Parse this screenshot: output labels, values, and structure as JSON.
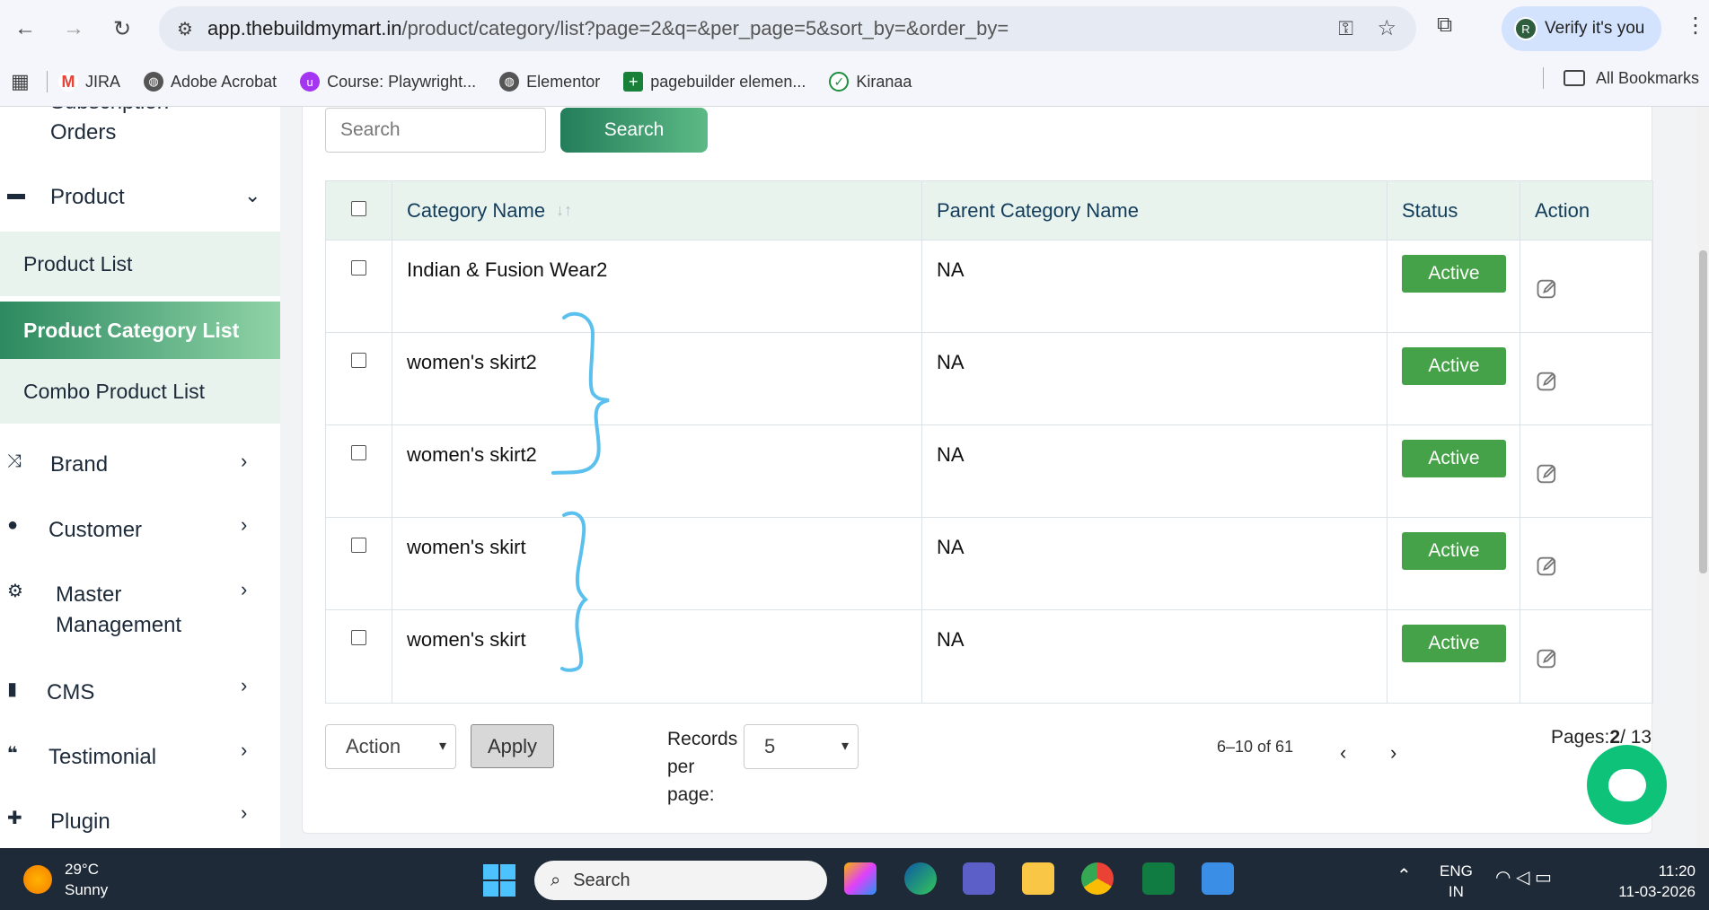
{
  "browser": {
    "url_host": "app.thebuildmymart.in",
    "url_path": "/product/category/list?page=2&q=&per_page=5&sort_by=&order_by=",
    "verify_label": "Verify it's you",
    "avatar_letter": "R"
  },
  "bookmarks": {
    "items": [
      {
        "label": "JIRA",
        "icon": "gmail-icon",
        "color": "#ea4335"
      },
      {
        "label": "Adobe Acrobat",
        "icon": "globe-icon",
        "color": "#555555"
      },
      {
        "label": "Course: Playwright...",
        "icon": "udemy-icon",
        "color": "#a435f0"
      },
      {
        "label": "Elementor",
        "icon": "globe-icon",
        "color": "#555555"
      },
      {
        "label": "pagebuilder elemen...",
        "icon": "sheets-icon",
        "color": "#188038"
      },
      {
        "label": "Kiranaa",
        "icon": "check-icon",
        "color": "#1e8e3e"
      }
    ],
    "all_label": "All Bookmarks"
  },
  "sidebar": {
    "partial_label": "Subscription",
    "orders_label": "Orders",
    "product_label": "Product",
    "sub_items": [
      "Product List",
      "Product Category List",
      "Combo Product List"
    ],
    "items": [
      {
        "label": "Brand",
        "icon": "shuffle-icon"
      },
      {
        "label": "Customer",
        "icon": "user-icon"
      },
      {
        "label": "Master Management",
        "icon": "user-gear-icon"
      },
      {
        "label": "CMS",
        "icon": "file-icon"
      },
      {
        "label": "Testimonial",
        "icon": "quote-icon"
      },
      {
        "label": "Plugin",
        "icon": "puzzle-icon"
      }
    ]
  },
  "search": {
    "placeholder": "Search",
    "button_label": "Search"
  },
  "table": {
    "headers": [
      "Category Name",
      "Parent Category Name",
      "Status",
      "Action"
    ],
    "rows": [
      {
        "name": "Indian & Fusion Wear2",
        "parent": "NA",
        "status": "Active"
      },
      {
        "name": "women's skirt2",
        "parent": "NA",
        "status": "Active"
      },
      {
        "name": "women's skirt2",
        "parent": "NA",
        "status": "Active"
      },
      {
        "name": "women's skirt",
        "parent": "NA",
        "status": "Active"
      },
      {
        "name": "women's skirt",
        "parent": "NA",
        "status": "Active"
      }
    ]
  },
  "footer": {
    "action_select": "Action",
    "apply_label": "Apply",
    "records_label_1": "Records",
    "records_label_2": "per",
    "records_label_3": "page:",
    "per_page": "5",
    "range": "6–10 of 61",
    "pages_label": "Pages:",
    "current_page": "2",
    "total_pages": "/ 13"
  },
  "taskbar": {
    "temp": "29°C",
    "weather": "Sunny",
    "search_label": "Search",
    "lang_1": "ENG",
    "lang_2": "IN",
    "time": "11:20",
    "date": "11-03-2026"
  },
  "colors": {
    "accent_green": "#237d5a",
    "active_badge": "#46a248",
    "annotation": "#5bc0ee"
  }
}
